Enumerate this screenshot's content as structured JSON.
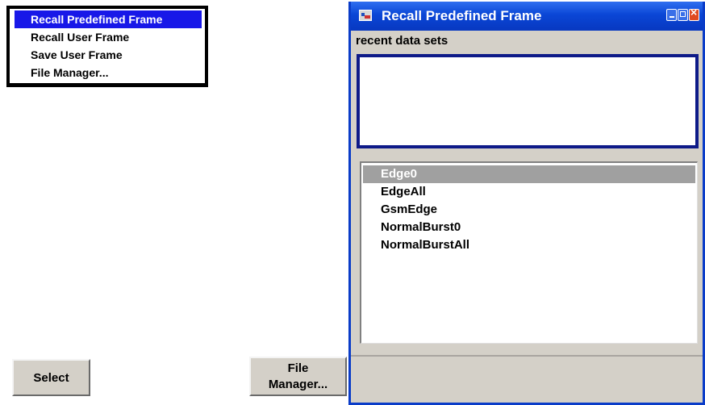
{
  "context_menu": {
    "items": [
      {
        "label": "Recall Predefined Frame",
        "selected": true
      },
      {
        "label": "Recall User Frame",
        "selected": false
      },
      {
        "label": "Save User Frame",
        "selected": false
      },
      {
        "label": "File Manager...",
        "selected": false
      }
    ]
  },
  "dialog": {
    "title": "Recall Predefined Frame",
    "recent_label": "recent data sets",
    "files": [
      {
        "name": "Edge0",
        "selected": true
      },
      {
        "name": "EdgeAll",
        "selected": false
      },
      {
        "name": "GsmEdge",
        "selected": false
      },
      {
        "name": "NormalBurst0",
        "selected": false
      },
      {
        "name": "NormalBurstAll",
        "selected": false
      }
    ],
    "select_button": "Select",
    "file_manager_button": "File\nManager..."
  },
  "colors": {
    "menu_highlight": "#1818e8",
    "titlebar": "#0a46d6",
    "recent_box_border": "#0d1a88",
    "list_selection": "#a0a0a0",
    "dialog_background": "#d4d0c8"
  },
  "icons": [
    "app-icon",
    "minimize-icon",
    "maximize-icon",
    "close-icon"
  ]
}
